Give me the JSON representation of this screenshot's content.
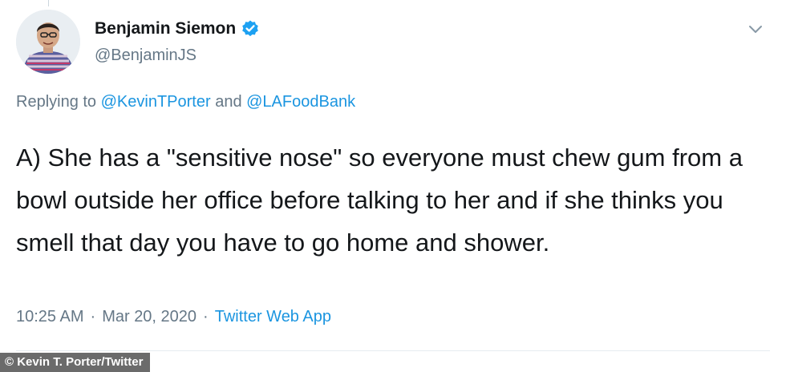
{
  "user": {
    "display_name": "Benjamin Siemon",
    "handle": "@BenjaminJS",
    "verified": true,
    "avatar_icon": "avatar"
  },
  "reply": {
    "prefix": "Replying to ",
    "mention_1": "@KevinTPorter",
    "joiner": " and ",
    "mention_2": "@LAFoodBank"
  },
  "tweet_text": "A) She has a \"sensitive nose\" so everyone must chew gum from a bowl outside her office before talking to her and if she thinks you smell that day you have to go home and shower.",
  "meta": {
    "time": "10:25 AM",
    "separator": "·",
    "date": "Mar 20, 2020",
    "source": "Twitter Web App"
  },
  "credit": "© Kevin T. Porter/Twitter",
  "colors": {
    "link": "#1b95e0",
    "verified": "#1da1f2",
    "muted": "#657786",
    "text": "#14171a"
  }
}
